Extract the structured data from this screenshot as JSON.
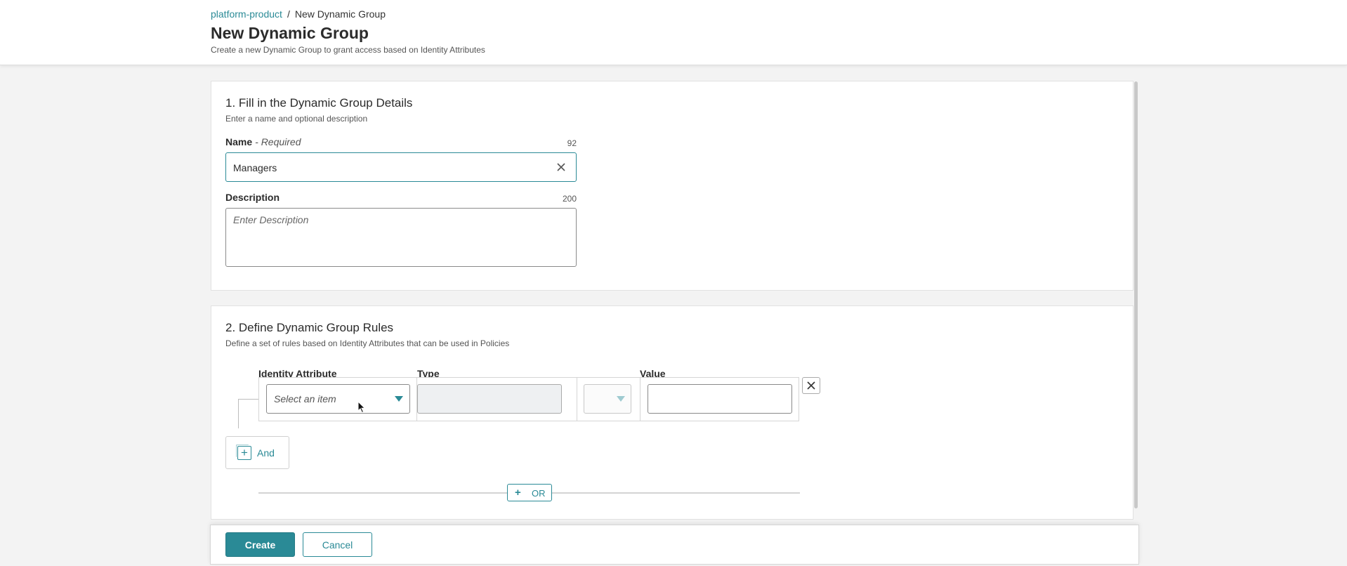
{
  "breadcrumb": {
    "parent": "platform-product",
    "separator": "/",
    "current": "New Dynamic Group"
  },
  "header": {
    "title": "New Dynamic Group",
    "subtitle": "Create a new Dynamic Group to grant access based on Identity Attributes"
  },
  "details_section": {
    "title": "1. Fill in the Dynamic Group Details",
    "subtitle": "Enter a name and optional description",
    "name_label": "Name",
    "name_required": "- Required",
    "name_counter": "92",
    "name_value": "Managers",
    "description_label": "Description",
    "description_counter": "200",
    "description_placeholder": "Enter Description"
  },
  "rules_section": {
    "title": "2. Define Dynamic Group Rules",
    "subtitle": "Define a set of rules based on Identity Attributes that can be used in Policies",
    "columns": {
      "attribute": "Identity Attribute",
      "type": "Type",
      "value": "Value"
    },
    "attribute_placeholder": "Select an item",
    "and_label": "And",
    "or_label": "OR"
  },
  "footer": {
    "create_label": "Create",
    "cancel_label": "Cancel"
  },
  "icons": {
    "clear": "close-icon",
    "remove_rule": "close-icon",
    "dropdown": "chevron-down-icon",
    "add": "plus-icon"
  },
  "colors": {
    "accent": "#2a8a96",
    "background": "#f3f3f3",
    "panel": "#ffffff",
    "text": "#2b2b2b"
  }
}
